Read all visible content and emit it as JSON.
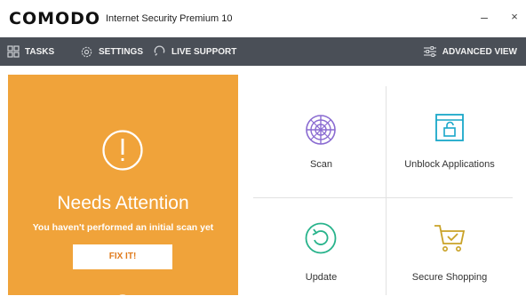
{
  "app": {
    "logo": "COMODO",
    "product_name": "Internet Security Premium 10",
    "minimize_glyph": "–",
    "close_glyph": "×"
  },
  "toolbar": {
    "tasks_label": "TASKS",
    "settings_label": "SETTINGS",
    "live_support_label": "LIVE SUPPORT",
    "advanced_view_label": "ADVANCED VIEW"
  },
  "status": {
    "heading": "Needs Attention",
    "message": "You haven't performed an initial scan yet",
    "fix_button_label": "FIX IT!"
  },
  "tiles": {
    "scan": "Scan",
    "unblock": "Unblock Applications",
    "update": "Update",
    "secure_shopping": "Secure Shopping"
  },
  "colors": {
    "accent": "#f0a33a",
    "toolbar": "#4a4f57",
    "scan_icon": "#8a6bd1",
    "unblock_icon": "#19a7c9",
    "update_icon": "#27b38b",
    "shopping_icon": "#c9a227"
  }
}
